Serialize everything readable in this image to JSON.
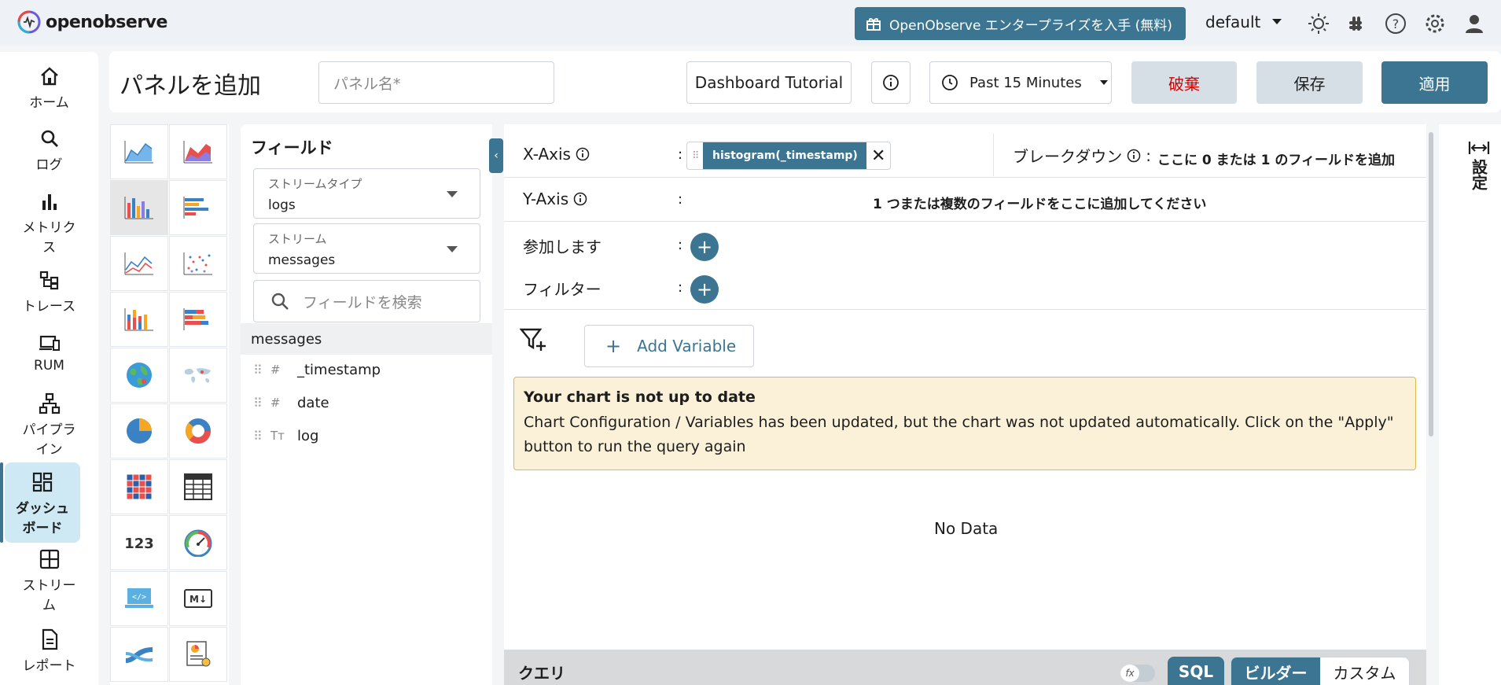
{
  "topbar": {
    "logo_text": "openobserve",
    "enterprise_label": "OpenObserve エンタープライズを入手 (無料)",
    "org": "default"
  },
  "nav": {
    "items": [
      {
        "label": "ホーム"
      },
      {
        "label": "ログ"
      },
      {
        "label": "メトリクス"
      },
      {
        "label": "トレース"
      },
      {
        "label": "RUM"
      },
      {
        "label": "パイプライン"
      },
      {
        "label": "ダッシュボード"
      },
      {
        "label": "ストリーム"
      },
      {
        "label": "レポート"
      }
    ]
  },
  "header": {
    "title": "パネルを追加",
    "panel_name_placeholder": "パネル名*",
    "tutorial_label": "Dashboard Tutorial",
    "time_range": "Past 15 Minutes",
    "discard_label": "破棄",
    "save_label": "保存",
    "apply_label": "適用"
  },
  "fields_panel": {
    "title": "フィールド",
    "stream_type_label": "ストリームタイプ",
    "stream_type_value": "logs",
    "stream_label": "ストリーム",
    "stream_value": "messages",
    "search_placeholder": "フィールドを検索",
    "stream_name": "messages",
    "fields": [
      {
        "name": "_timestamp",
        "type": "#"
      },
      {
        "name": "date",
        "type": "#"
      },
      {
        "name": "log",
        "type": "Tт"
      }
    ]
  },
  "builder": {
    "x_axis_label": "X-Axis",
    "x_axis_chip": "histogram(_timestamp)",
    "breakdown_label": "ブレークダウン",
    "breakdown_hint": "ここに 0 または 1 のフィールドを追加",
    "y_axis_label": "Y-Axis",
    "y_axis_hint": "1 つまたは複数のフィールドをここに追加してください",
    "join_label": "参加します",
    "filter_label": "フィルター",
    "colon": ":",
    "add_variable_label": "Add Variable",
    "warning_title": "Your chart is not up to date",
    "warning_body": "Chart Configuration / Variables has been updated, but the chart was not updated automatically. Click on the \"Apply\" button to run the query again",
    "no_data": "No Data"
  },
  "query": {
    "label": "クエリ",
    "fx_label": "fx",
    "sql_label": "SQL",
    "builder_label": "ビルダー",
    "custom_label": "カスタム"
  },
  "settings_rail": {
    "label": "設定"
  },
  "colors": {
    "accent": "#3b7592",
    "discard_text": "#d40000",
    "warning_bg": "#fbf1d9",
    "warning_border": "#e3b64c",
    "nav_active_bg": "#cfe9f4"
  }
}
